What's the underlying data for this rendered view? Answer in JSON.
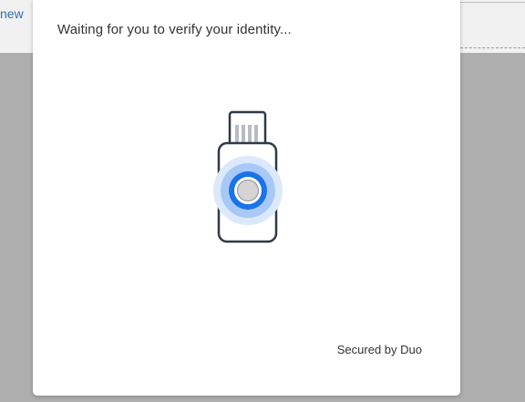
{
  "background": {
    "link_text": "new"
  },
  "dialog": {
    "status_text": "Waiting for you to verify your identity...",
    "footer_text": "Secured by Duo",
    "icon": "security-key-icon"
  },
  "colors": {
    "accent": "#1a73e8",
    "ring": "#bcd7fb",
    "key_outline": "#2f3a46"
  }
}
